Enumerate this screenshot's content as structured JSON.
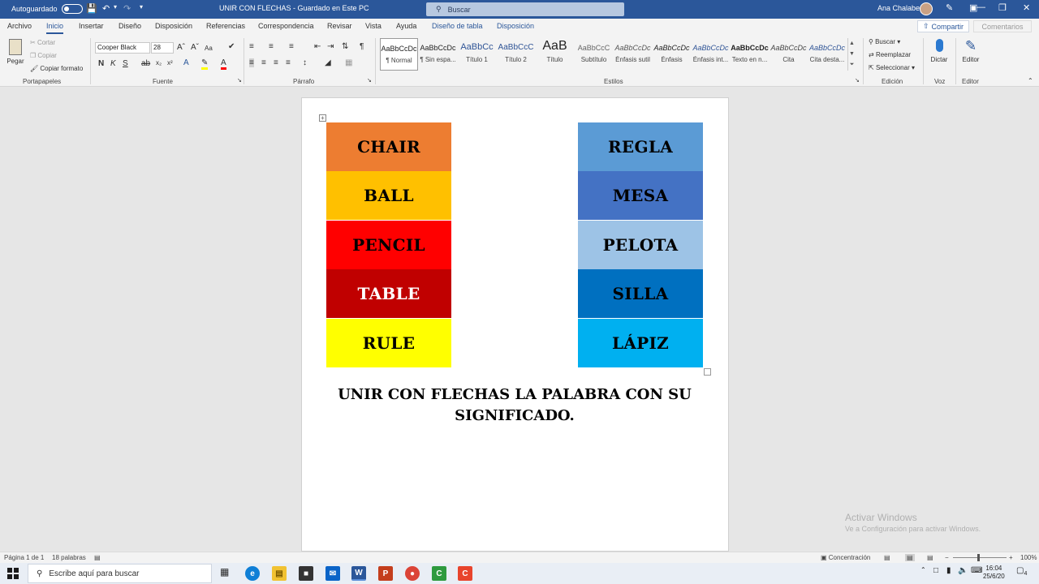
{
  "titlebar": {
    "autosave_label": "Autoguardado",
    "doc_title": "UNIR CON FLECHAS  -  Guardado en Este PC",
    "search_placeholder": "Buscar",
    "user_name": "Ana Chalabe"
  },
  "tabs": [
    "Archivo",
    "Inicio",
    "Insertar",
    "Diseño",
    "Disposición",
    "Referencias",
    "Correspondencia",
    "Revisar",
    "Vista",
    "Ayuda",
    "Diseño de tabla",
    "Disposición"
  ],
  "share_label": "Compartir",
  "comments_label": "Comentarios",
  "clipboard": {
    "paste": "Pegar",
    "cut": "Cortar",
    "copy": "Copiar",
    "format_painter": "Copiar formato",
    "label": "Portapapeles"
  },
  "font": {
    "name": "Cooper Black",
    "size": "28",
    "case": "Aa",
    "label": "Fuente",
    "bold": "N",
    "italic": "K",
    "underline": "S"
  },
  "paragraph": {
    "label": "Párrafo"
  },
  "styles": {
    "label": "Estilos",
    "items": [
      {
        "sample": "AaBbCcDc",
        "name": "¶ Normal"
      },
      {
        "sample": "AaBbCcDc",
        "name": "¶ Sin espa..."
      },
      {
        "sample": "AaBbCc",
        "name": "Título 1"
      },
      {
        "sample": "AaBbCcC",
        "name": "Título 2"
      },
      {
        "sample": "AaB",
        "name": "Título"
      },
      {
        "sample": "AaBbCcC",
        "name": "Subtítulo"
      },
      {
        "sample": "AaBbCcDc",
        "name": "Énfasis sutil"
      },
      {
        "sample": "AaBbCcDc",
        "name": "Énfasis"
      },
      {
        "sample": "AaBbCcDc",
        "name": "Énfasis int..."
      },
      {
        "sample": "AaBbCcDc",
        "name": "Texto en n..."
      },
      {
        "sample": "AaBbCcDc",
        "name": "Cita"
      },
      {
        "sample": "AaBbCcDc",
        "name": "Cita desta..."
      }
    ]
  },
  "editing": {
    "find": "Buscar",
    "replace": "Reemplazar",
    "select": "Seleccionar",
    "label": "Edición"
  },
  "voice": {
    "dictate": "Dictar",
    "label": "Voz"
  },
  "editor": {
    "button": "Editor",
    "label": "Editor"
  },
  "document": {
    "english_words": [
      "CHAIR",
      "BALL",
      "PENCIL",
      "TABLE",
      "RULE"
    ],
    "english_colors": [
      "#ED7D31",
      "#FFC000",
      "#FF0000",
      "#C00000",
      "#FFFF00"
    ],
    "english_text_colors": [
      "#000000",
      "#000000",
      "#000000",
      "#FFFFFF",
      "#000000"
    ],
    "spanish_words": [
      "REGLA",
      "MESA",
      "PELOTA",
      "SILLA",
      "LÁPIZ"
    ],
    "spanish_colors": [
      "#5B9BD5",
      "#4472C4",
      "#9DC3E6",
      "#0070C0",
      "#00B0F0"
    ],
    "instruction": "UNIR CON FLECHAS LA PALABRA CON SU SIGNIFICADO."
  },
  "watermark": {
    "title": "Activar Windows",
    "subtitle": "Ve a Configuración para activar Windows."
  },
  "statusbar": {
    "page": "Página 1 de 1",
    "words": "18 palabras",
    "focus": "Concentración",
    "zoom": "100%"
  },
  "taskbar": {
    "search_placeholder": "Escribe aquí para buscar",
    "time": "16:04",
    "date": "25/6/20",
    "notifications": "4"
  }
}
